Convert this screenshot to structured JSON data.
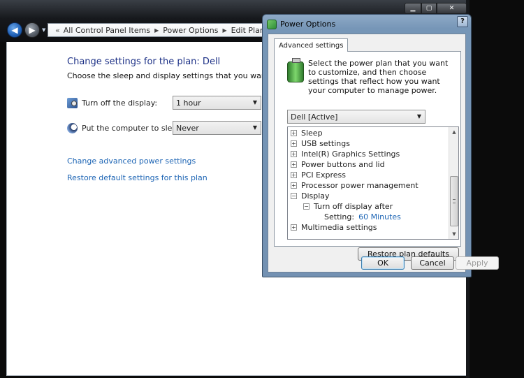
{
  "background_window": {
    "breadcrumb": {
      "lead": "«",
      "items": [
        "All Control Panel Items",
        "Power Options",
        "Edit Plan Settings"
      ]
    },
    "title": "Change settings for the plan: Dell",
    "subtitle": "Choose the sleep and display settings that you want your computer to use.",
    "settings": [
      {
        "label": "Turn off the display:",
        "value": "1 hour"
      },
      {
        "label": "Put the computer to sleep:",
        "value": "Never"
      }
    ],
    "links": {
      "advanced": "Change advanced power settings",
      "restore": "Restore default settings for this plan"
    }
  },
  "dialog": {
    "title": "Power Options",
    "help_glyph": "?",
    "tab_label": "Advanced settings",
    "intro": "Select the power plan that you want to customize, and then choose settings that reflect how you want your computer to manage power.",
    "plan_select": "Dell [Active]",
    "tree": [
      {
        "label": "Sleep",
        "expander": "+",
        "level": 1
      },
      {
        "label": "USB settings",
        "expander": "+",
        "level": 1
      },
      {
        "label": "Intel(R) Graphics Settings",
        "expander": "+",
        "level": 1
      },
      {
        "label": "Power buttons and lid",
        "expander": "+",
        "level": 1
      },
      {
        "label": "PCI Express",
        "expander": "+",
        "level": 1
      },
      {
        "label": "Processor power management",
        "expander": "+",
        "level": 1
      },
      {
        "label": "Display",
        "expander": "−",
        "level": 1
      },
      {
        "label": "Turn off display after",
        "expander": "−",
        "level": 2
      },
      {
        "label": "Setting:",
        "value": "60 Minutes",
        "level": 3
      },
      {
        "label": "Multimedia settings",
        "expander": "+",
        "level": 1
      }
    ],
    "buttons": {
      "restore": "Restore plan defaults",
      "ok": "OK",
      "cancel": "Cancel",
      "apply": "Apply"
    }
  },
  "colors": {
    "link": "#1c64b4",
    "title": "#1e3287"
  }
}
